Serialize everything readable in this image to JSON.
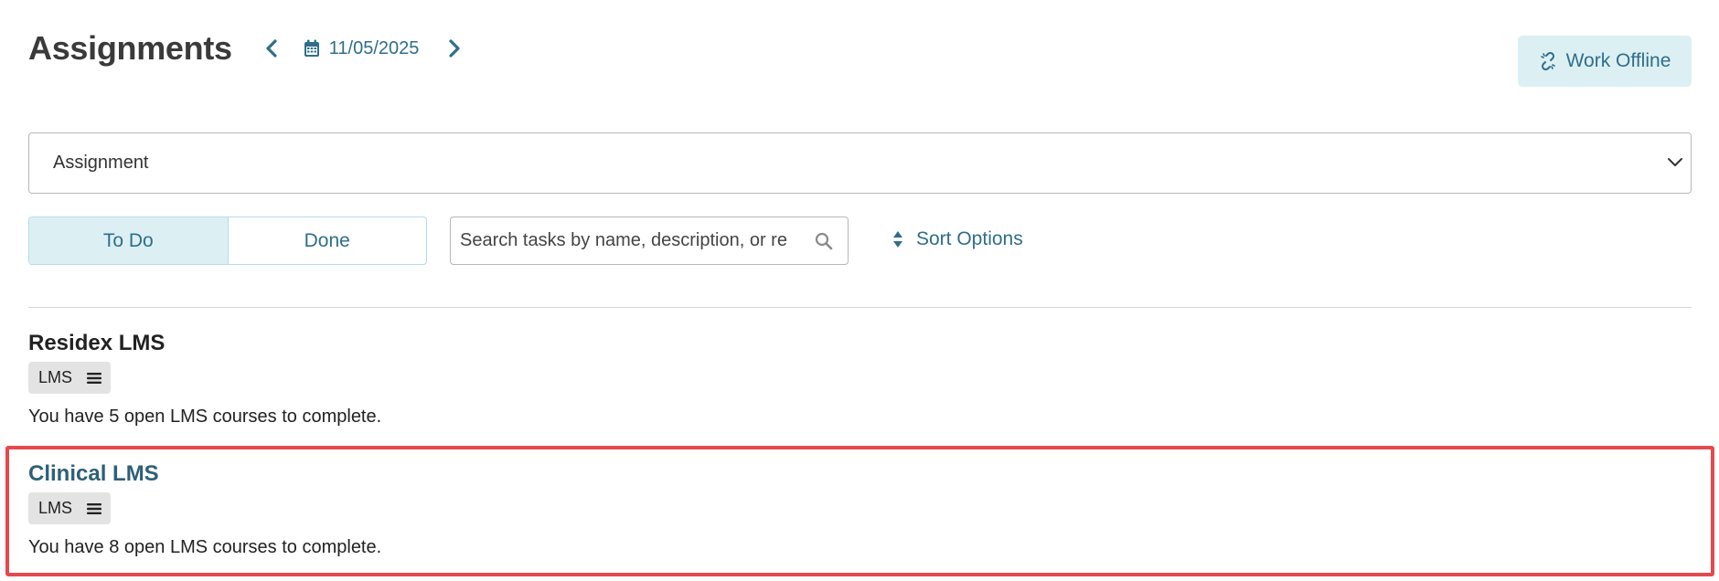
{
  "header": {
    "title": "Assignments",
    "date": "11/05/2025",
    "work_offline_label": "Work Offline"
  },
  "filter": {
    "selected": "Assignment"
  },
  "tabs": [
    {
      "label": "To Do",
      "active": true
    },
    {
      "label": "Done",
      "active": false
    }
  ],
  "search": {
    "placeholder": "Search tasks by name, description, or re",
    "value": ""
  },
  "sort": {
    "label": "Sort Options"
  },
  "tasks": [
    {
      "title": "Residex LMS",
      "tag": "LMS",
      "description": "You have 5 open LMS courses to complete."
    },
    {
      "title": "Clinical LMS",
      "tag": "LMS",
      "description": "You have 8 open LMS courses to complete."
    }
  ],
  "colors": {
    "accent": "#2f6e8a",
    "accent_bg": "#dcf0f4",
    "highlight": "#e5484d"
  }
}
